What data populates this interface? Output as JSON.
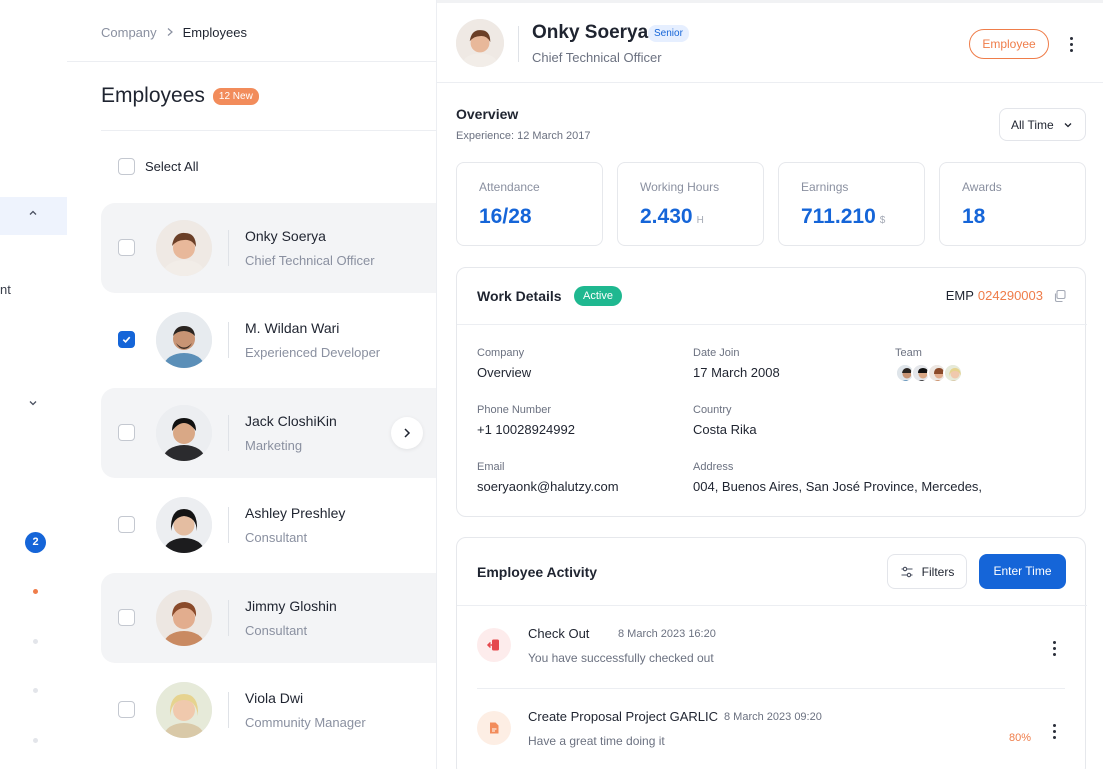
{
  "sidebar": {
    "partial_text": "nt",
    "badge_count": "2"
  },
  "breadcrumb": {
    "root": "Company",
    "separator": ">",
    "current": "Employees"
  },
  "list": {
    "title": "Employees",
    "new_badge": "12 New",
    "select_all": "Select All",
    "employees": [
      {
        "name": "Onky Soerya",
        "role": "Chief Technical Officer",
        "checked": false
      },
      {
        "name": "M. Wildan Wari",
        "role": "Experienced Developer",
        "checked": true
      },
      {
        "name": "Jack CloshiKin",
        "role": "Marketing",
        "checked": false
      },
      {
        "name": "Ashley Preshley",
        "role": "Consultant",
        "checked": false
      },
      {
        "name": "Jimmy Gloshin",
        "role": "Consultant",
        "checked": false
      },
      {
        "name": "Viola Dwi",
        "role": "Community Manager",
        "checked": false
      }
    ]
  },
  "profile": {
    "name": "Onky Soerya",
    "level_badge": "Senior",
    "title": "Chief Technical Officer",
    "type_button": "Employee"
  },
  "overview": {
    "title": "Overview",
    "experience": "Experience:  12 March 2017",
    "time_filter": "All Time",
    "stats": [
      {
        "label": "Attendance",
        "value": "16/28",
        "unit": ""
      },
      {
        "label": "Working Hours",
        "value": "2.430",
        "unit": "H"
      },
      {
        "label": "Earnings",
        "value": "711.210",
        "unit": "$"
      },
      {
        "label": "Awards",
        "value": "18",
        "unit": ""
      }
    ]
  },
  "work_details": {
    "title": "Work Details",
    "status": "Active",
    "emp_prefix": "EMP",
    "emp_id": "024290003",
    "fields": {
      "company_label": "Company",
      "company_value": "Overview",
      "date_join_label": "Date Join",
      "date_join_value": "17 March 2008",
      "team_label": "Team",
      "phone_label": "Phone Number",
      "phone_value": "+1 10028924992",
      "country_label": "Country",
      "country_value": "Costa Rika",
      "email_label": "Email",
      "email_value": "soeryaonk@halutzy.com",
      "address_label": "Address",
      "address_value": "004, Buenos Aires, San José Province, Mercedes,"
    }
  },
  "activity": {
    "title": "Employee Activity",
    "filters_label": "Filters",
    "enter_time_label": "Enter Time",
    "items": [
      {
        "name": "Check Out",
        "time": "8 March 2023  16:20",
        "desc": "You have successfully checked out",
        "progress": ""
      },
      {
        "name": "Create Proposal Project GARLIC",
        "time": "8 March 2023  09:20",
        "desc": "Have a great time doing it",
        "progress": "80%"
      }
    ]
  },
  "colors": {
    "accent_blue": "#1565d8",
    "accent_orange": "#ef7d4a",
    "status_green": "#1fb890"
  }
}
